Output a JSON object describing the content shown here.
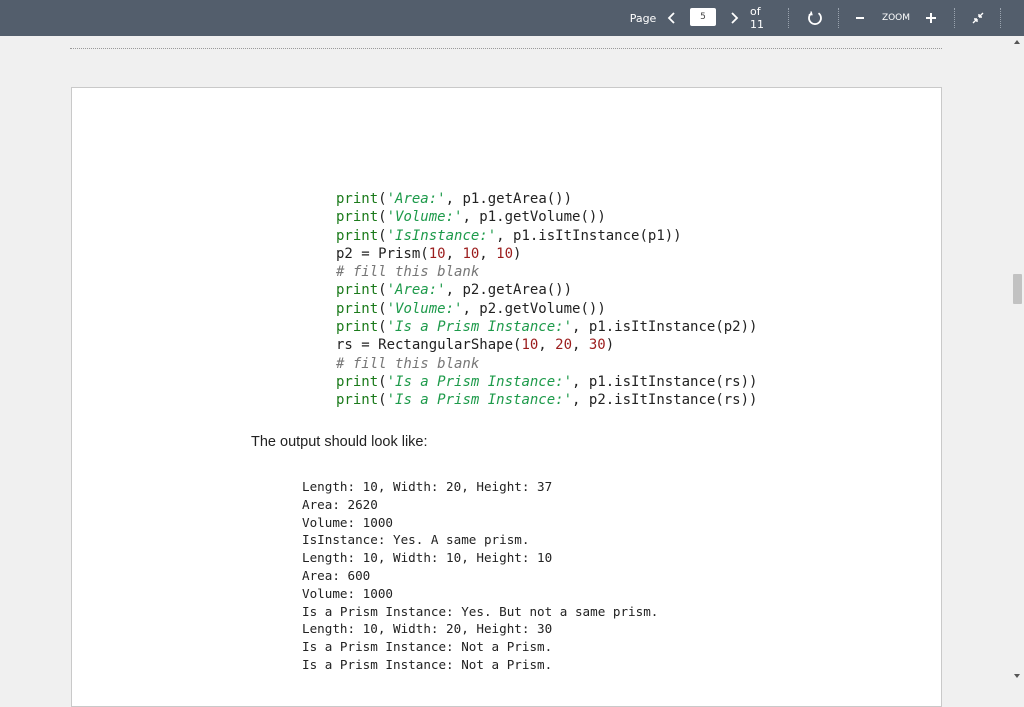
{
  "toolbar": {
    "page_label": "Page",
    "page_value": "5",
    "of_label": "of 11",
    "zoom_label": "ZOOM",
    "prev_icon": "chevron-left",
    "next_icon": "chevron-right",
    "rotate_icon": "rotate",
    "zoom_out_icon": "minus",
    "zoom_in_icon": "plus",
    "exit_fullscreen_icon": "collapse"
  },
  "code_lines": [
    [
      {
        "t": "print",
        "c": "kw"
      },
      {
        "t": "(",
        "c": ""
      },
      {
        "t": "'Area:'",
        "c": "str"
      },
      {
        "t": ", p1.getArea())",
        "c": ""
      }
    ],
    [
      {
        "t": "print",
        "c": "kw"
      },
      {
        "t": "(",
        "c": ""
      },
      {
        "t": "'Volume:'",
        "c": "str"
      },
      {
        "t": ", p1.getVolume())",
        "c": ""
      }
    ],
    [
      {
        "t": "print",
        "c": "kw"
      },
      {
        "t": "(",
        "c": ""
      },
      {
        "t": "'IsInstance:'",
        "c": "str"
      },
      {
        "t": ", p1.isItInstance(p1))",
        "c": ""
      }
    ],
    [
      {
        "t": "p2 = Prism(",
        "c": ""
      },
      {
        "t": "10",
        "c": "num"
      },
      {
        "t": ", ",
        "c": ""
      },
      {
        "t": "10",
        "c": "num"
      },
      {
        "t": ", ",
        "c": ""
      },
      {
        "t": "10",
        "c": "num"
      },
      {
        "t": ")",
        "c": ""
      }
    ],
    [
      {
        "t": "# fill this blank",
        "c": "cmt"
      }
    ],
    [
      {
        "t": "print",
        "c": "kw"
      },
      {
        "t": "(",
        "c": ""
      },
      {
        "t": "'Area:'",
        "c": "str"
      },
      {
        "t": ", p2.getArea())",
        "c": ""
      }
    ],
    [
      {
        "t": "print",
        "c": "kw"
      },
      {
        "t": "(",
        "c": ""
      },
      {
        "t": "'Volume:'",
        "c": "str"
      },
      {
        "t": ", p2.getVolume())",
        "c": ""
      }
    ],
    [
      {
        "t": "print",
        "c": "kw"
      },
      {
        "t": "(",
        "c": ""
      },
      {
        "t": "'Is a Prism Instance:'",
        "c": "str"
      },
      {
        "t": ", p1.isItInstance(p2))",
        "c": ""
      }
    ],
    [
      {
        "t": "rs = RectangularShape(",
        "c": ""
      },
      {
        "t": "10",
        "c": "num"
      },
      {
        "t": ", ",
        "c": ""
      },
      {
        "t": "20",
        "c": "num"
      },
      {
        "t": ", ",
        "c": ""
      },
      {
        "t": "30",
        "c": "num"
      },
      {
        "t": ")",
        "c": ""
      }
    ],
    [
      {
        "t": "# fill this blank",
        "c": "cmt"
      }
    ],
    [
      {
        "t": "print",
        "c": "kw"
      },
      {
        "t": "(",
        "c": ""
      },
      {
        "t": "'Is a Prism Instance:'",
        "c": "str"
      },
      {
        "t": ", p1.isItInstance(rs))",
        "c": ""
      }
    ],
    [
      {
        "t": "print",
        "c": "kw"
      },
      {
        "t": "(",
        "c": ""
      },
      {
        "t": "'Is a Prism Instance:'",
        "c": "str"
      },
      {
        "t": ", p2.isItInstance(rs))",
        "c": ""
      }
    ]
  ],
  "description": "The output should look like:",
  "output_lines": [
    "Length: 10, Width: 20, Height: 37",
    "Area: 2620",
    "Volume: 1000",
    "IsInstance: Yes. A same prism.",
    "Length: 10, Width: 10, Height: 10",
    "Area: 600",
    "Volume: 1000",
    "Is a Prism Instance: Yes. But not a same prism.",
    "Length: 10, Width: 20, Height: 30",
    "Is a Prism Instance: Not a Prism.",
    "Is a Prism Instance: Not a Prism."
  ]
}
